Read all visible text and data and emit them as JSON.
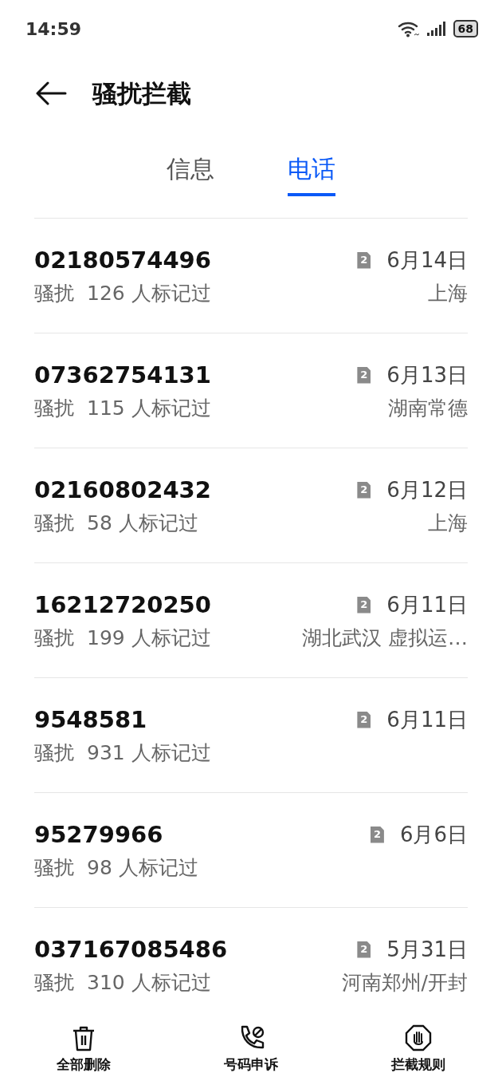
{
  "status_bar": {
    "time": "14:59",
    "battery": "68"
  },
  "header": {
    "title": "骚扰拦截"
  },
  "tabs": [
    {
      "label": "信息",
      "selected": false
    },
    {
      "label": "电话",
      "selected": true
    }
  ],
  "calls": [
    {
      "number": "02180574496",
      "sim": "2",
      "tag": "骚扰",
      "marks": "126 人标记过",
      "date": "6月14日",
      "location": "上海"
    },
    {
      "number": "07362754131",
      "sim": "2",
      "tag": "骚扰",
      "marks": "115 人标记过",
      "date": "6月13日",
      "location": "湖南常德"
    },
    {
      "number": "02160802432",
      "sim": "2",
      "tag": "骚扰",
      "marks": "58 人标记过",
      "date": "6月12日",
      "location": "上海"
    },
    {
      "number": "16212720250",
      "sim": "2",
      "tag": "骚扰",
      "marks": "199 人标记过",
      "date": "6月11日",
      "location": "湖北武汉 虚拟运…"
    },
    {
      "number": "9548581",
      "sim": "2",
      "tag": "骚扰",
      "marks": "931 人标记过",
      "date": "6月11日"
    },
    {
      "number": "95279966",
      "sim": "2",
      "tag": "骚扰",
      "marks": "98 人标记过",
      "date": "6月6日"
    },
    {
      "number": "037167085486",
      "sim": "2",
      "tag": "骚扰",
      "marks": "310 人标记过",
      "date": "5月31日",
      "location": "河南郑州/开封"
    }
  ],
  "bottom_bar": [
    {
      "kind": "delete",
      "label": "全部删除"
    },
    {
      "kind": "appeal",
      "label": "号码申诉"
    },
    {
      "kind": "rules",
      "label": "拦截规则"
    }
  ]
}
